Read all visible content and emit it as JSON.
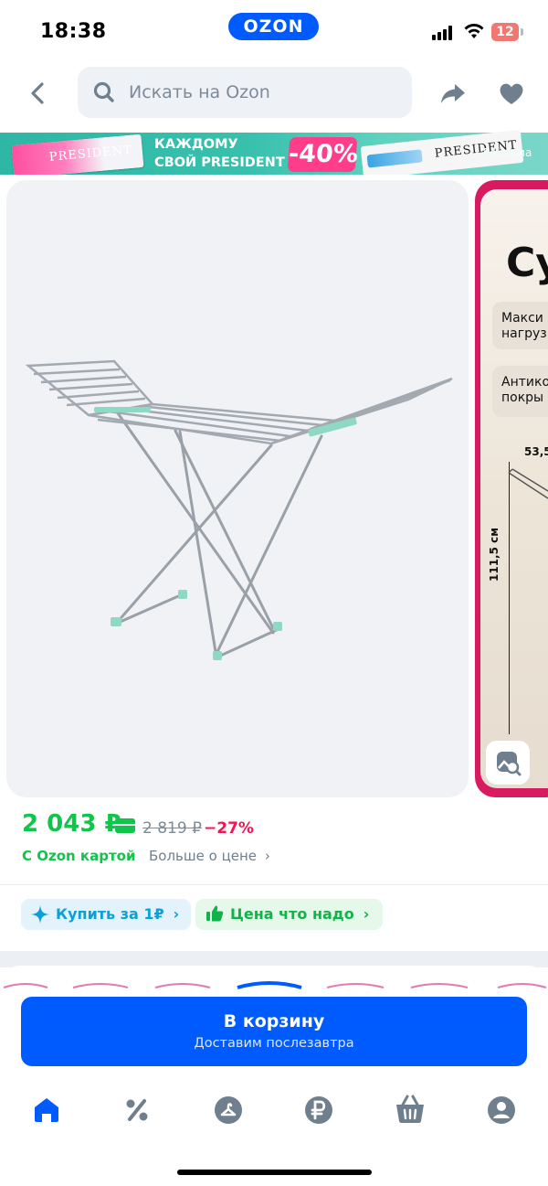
{
  "status_bar": {
    "time": "18:38",
    "brand": "OZON",
    "battery": "12"
  },
  "search": {
    "placeholder": "Искать на Ozon"
  },
  "ad_banner": {
    "line1": "КАЖДОМУ",
    "line2": "СВОЙ PRESIDENT",
    "discount": "-40%",
    "brand": "PRESIDENT",
    "ad_label": "Реклама"
  },
  "gallery": {
    "second_slide": {
      "title": "Су",
      "feature1": "Макси\nнагруз",
      "feature2": "Антико\nпокры",
      "width_dim": "53,5",
      "height_dim": "111,5 см"
    }
  },
  "price": {
    "current": "2 043 ₽",
    "old": "2 819 ₽",
    "discount": "−27%",
    "with_card": "С Ozon картой",
    "more": "Больше о цене"
  },
  "chips": [
    {
      "label": "Купить за 1₽"
    },
    {
      "label": "Цена что надо"
    }
  ],
  "cart": {
    "title": "В корзину",
    "subtitle": "Доставим послезавтра"
  },
  "colors": {
    "accent": "#005bff",
    "green": "#10c44c",
    "pink": "#f91155"
  },
  "tabbar": [
    "home-icon",
    "percent-icon",
    "catalog-icon",
    "ruble-icon",
    "cart-icon",
    "profile-icon"
  ]
}
